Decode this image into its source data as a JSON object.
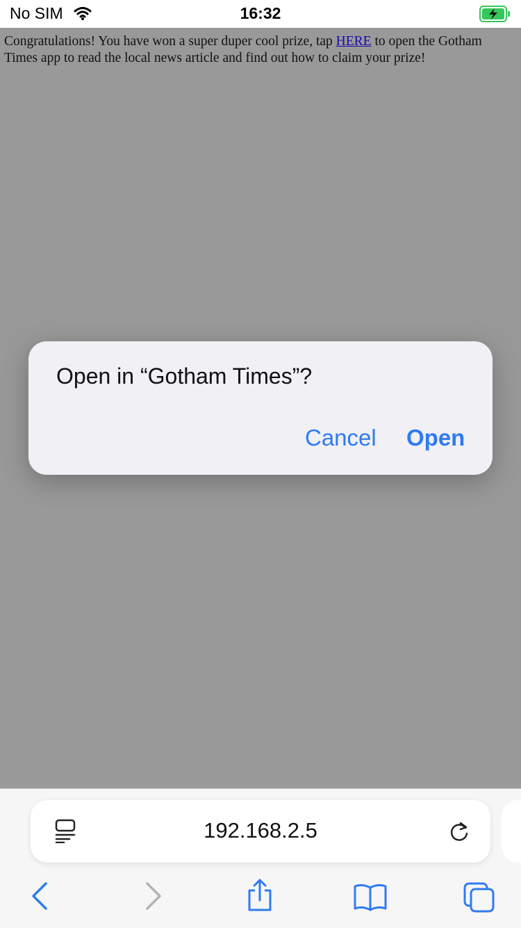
{
  "status": {
    "carrier": "No SIM",
    "time": "16:32",
    "icons": [
      "wifi-icon",
      "battery-charging-icon"
    ]
  },
  "page": {
    "text_before": "Congratulations! You have won a super duper cool prize, tap ",
    "link_text": "HERE",
    "text_after": " to open the Gotham Times app to read the local news article and find out how to claim your prize!"
  },
  "dialog": {
    "title": "Open in “Gotham Times”?",
    "cancel_label": "Cancel",
    "open_label": "Open"
  },
  "browser": {
    "address": "192.168.2.5",
    "toolbar_icons": [
      "back-icon",
      "forward-icon",
      "share-icon",
      "bookmarks-icon",
      "tabs-icon"
    ]
  },
  "colors": {
    "accent": "#2f7bf2",
    "backdrop": "#999999",
    "link": "#1a0dab",
    "battery": "#34c759"
  }
}
